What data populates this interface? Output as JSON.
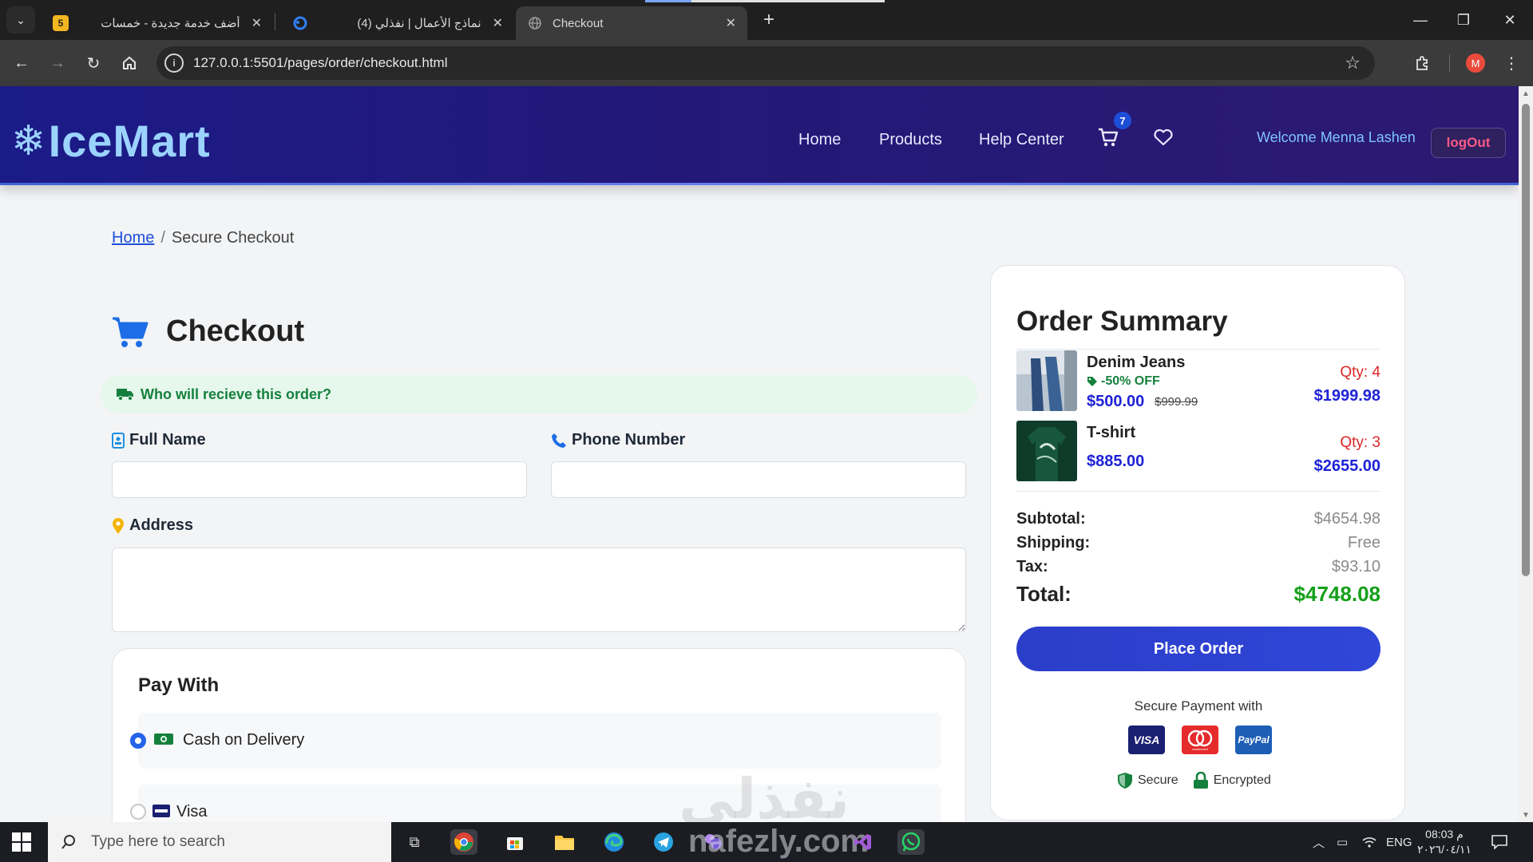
{
  "browser": {
    "tabs": [
      {
        "label": "أضف خدمة جديدة - خمسات",
        "favicon": "5"
      },
      {
        "label": "(4) نماذج الأعمال | نفذلي",
        "favicon": ""
      },
      {
        "label": "Checkout",
        "favicon": ""
      }
    ],
    "url": "127.0.0.1:5501/pages/order/checkout.html",
    "profile_initial": "M"
  },
  "header": {
    "logo": "IceMart",
    "nav": [
      "Home",
      "Products",
      "Help Center"
    ],
    "cart_count": "7",
    "welcome": "Welcome Menna Lashen",
    "logout": "logOut",
    "colors": {
      "bg": "#231878",
      "logo": "#9bd3ff",
      "accent": "#1d4ed8"
    }
  },
  "breadcrumb": {
    "home": "Home",
    "current": "Secure Checkout"
  },
  "checkout": {
    "title": "Checkout",
    "who": "Who will recieve this order?",
    "full_name": {
      "label": "Full Name",
      "value": "",
      "placeholder": ""
    },
    "phone": {
      "label": "Phone Number",
      "value": "",
      "placeholder": ""
    },
    "address": {
      "label": "Address",
      "value": "",
      "placeholder": ""
    },
    "pay": {
      "title": "Pay With",
      "options": [
        {
          "label": "Cash on Delivery",
          "selected": true
        },
        {
          "label": "Visa",
          "selected": false
        }
      ]
    }
  },
  "summary": {
    "title": "Order Summary",
    "items": [
      {
        "name": "Denim Jeans",
        "discount": "-50% OFF",
        "price": "$500.00",
        "old_price": "$999.99",
        "qty": "Qty: 4",
        "line_total": "$1999.98"
      },
      {
        "name": "T-shirt",
        "price": "$885.00",
        "qty": "Qty: 3",
        "line_total": "$2655.00"
      }
    ],
    "subtotal": {
      "label": "Subtotal:",
      "value": "$4654.98"
    },
    "shipping": {
      "label": "Shipping:",
      "value": "Free"
    },
    "tax": {
      "label": "Tax:",
      "value": "$93.10"
    },
    "total": {
      "label": "Total:",
      "value": "$4748.08"
    },
    "place_order": "Place Order",
    "secure_with": "Secure Payment with",
    "cards": [
      "VISA",
      "mastercard",
      "PayPal"
    ],
    "secure": "Secure",
    "encrypted": "Encrypted"
  },
  "watermark": "nafezly.com",
  "taskbar": {
    "search_placeholder": "Type here to search",
    "language": "ENG",
    "time": "08:03 م",
    "date": "٢٠٢٦/٠٤/١١"
  }
}
